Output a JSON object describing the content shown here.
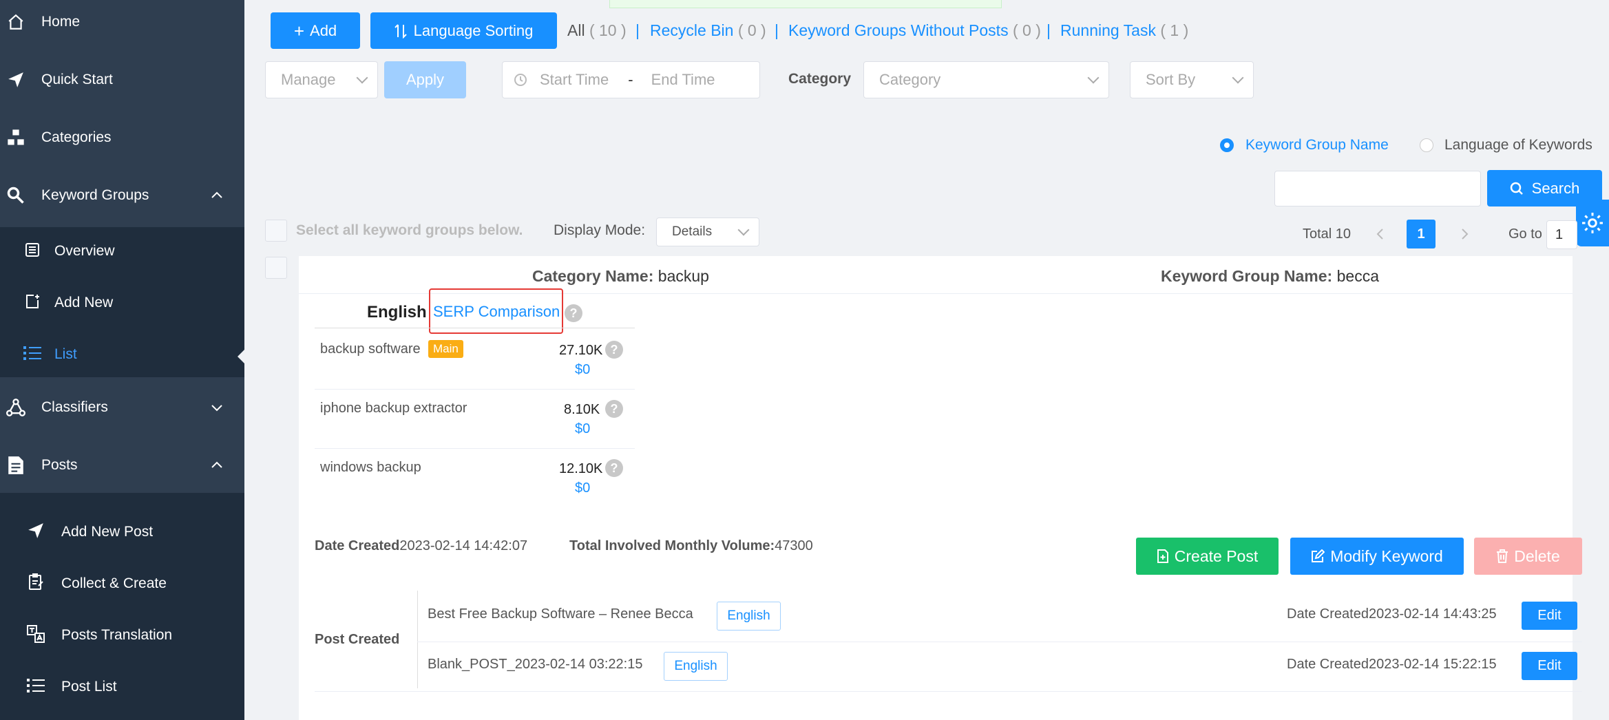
{
  "sidebar": {
    "home": "Home",
    "quick_start": "Quick Start",
    "categories": "Categories",
    "keyword_groups": "Keyword Groups",
    "keyword_groups_sub": {
      "overview": "Overview",
      "add_new": "Add New",
      "list": "List"
    },
    "classifiers": "Classifiers",
    "posts": "Posts",
    "posts_sub": {
      "add_new_post": "Add New Post",
      "collect_create": "Collect & Create",
      "posts_translation": "Posts Translation",
      "post_list": "Post List"
    }
  },
  "toolbar": {
    "add_label": "Add",
    "language_sorting_label": "Language Sorting",
    "all_label": "All",
    "all_count": "( 10 )",
    "recycle_bin_label": "Recycle Bin",
    "recycle_bin_count": "( 0 )",
    "without_posts_label": "Keyword Groups Without Posts",
    "without_posts_count": "( 0 )",
    "running_task_label": "Running Task",
    "running_task_count": "( 1 )",
    "separator": "|"
  },
  "filters": {
    "manage_placeholder": "Manage",
    "apply_label": "Apply",
    "start_time_placeholder": "Start Time",
    "date_separator": "-",
    "end_time_placeholder": "End Time",
    "category_label": "Category",
    "category_placeholder": "Category",
    "sort_by_placeholder": "Sort By"
  },
  "search": {
    "radio_group_name": "Keyword Group Name",
    "radio_language": "Language of Keywords",
    "search_value": "",
    "search_button": "Search"
  },
  "list_controls": {
    "select_all_label": "Select all keyword groups below.",
    "display_mode_label": "Display Mode:",
    "display_mode_value": "Details",
    "total_label": "Total 10",
    "current_page": "1",
    "goto_label": "Go to",
    "goto_value": "1"
  },
  "card": {
    "category_name_label": "Category Name:",
    "category_name_value": "backup",
    "keyword_group_name_label": "Keyword Group Name:",
    "keyword_group_name_value": "becca",
    "language": "English",
    "serp_comparison": "SERP Comparison",
    "main_badge": "Main",
    "keywords": [
      {
        "name": "backup software",
        "volume": "27.10K",
        "cpc": "$0"
      },
      {
        "name": "iphone backup extractor",
        "volume": "8.10K",
        "cpc": "$0"
      },
      {
        "name": "windows backup",
        "volume": "12.10K",
        "cpc": "$0"
      }
    ],
    "date_created_label": "Date Created",
    "date_created_value": "2023-02-14 14:42:07",
    "total_volume_label": "Total Involved Monthly Volume:",
    "total_volume_value": "47300",
    "create_post_label": "Create Post",
    "modify_keyword_label": "Modify Keyword",
    "delete_label": "Delete",
    "post_created_label": "Post Created",
    "posts": [
      {
        "title": "Best Free Backup Software – Renee Becca",
        "lang": "English",
        "date_label": "Date Created",
        "date": "2023-02-14 14:43:25",
        "edit": "Edit"
      },
      {
        "title": "Blank_POST_2023-02-14 03:22:15",
        "lang": "English",
        "date_label": "Date Created",
        "date": "2023-02-14 15:22:15",
        "edit": "Edit"
      }
    ]
  },
  "colors": {
    "sidebar_bg": "#2f3e50",
    "submenu_bg": "#1f2d3d",
    "primary": "#1890ff",
    "success": "#19c06a",
    "danger_disabled": "#fbb0b0",
    "badge": "#faad14",
    "highlight_box": "#e53935"
  },
  "icons": {
    "home": "home-icon",
    "quick_start": "paper-plane-icon",
    "categories": "hierarchy-icon",
    "keyword_groups": "magnifier-icon",
    "classifiers": "network-icon",
    "posts": "document-icon",
    "settings": "gear-icon"
  }
}
